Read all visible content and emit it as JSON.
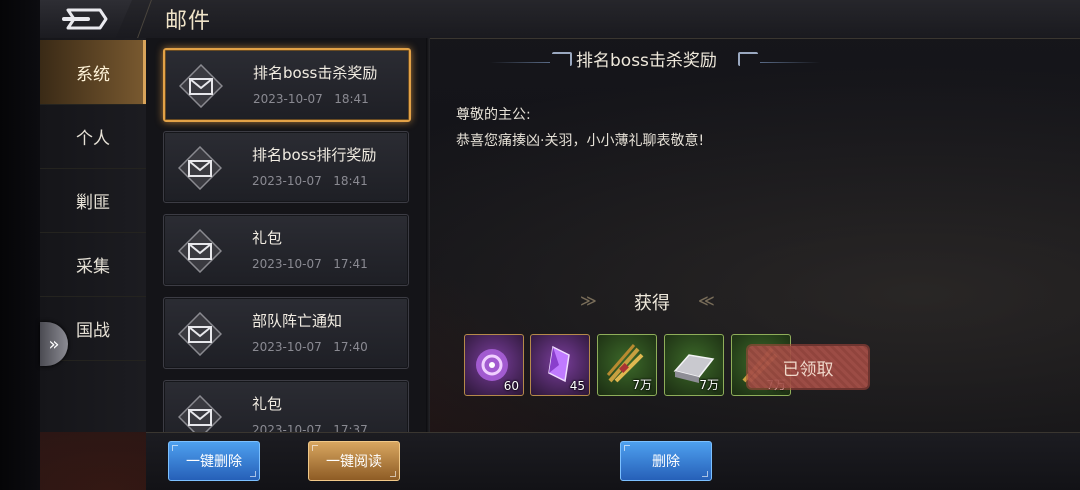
{
  "header": {
    "title": "邮件"
  },
  "sidebar": {
    "items": [
      {
        "label": "系统",
        "active": true
      },
      {
        "label": "个人"
      },
      {
        "label": "剿匪"
      },
      {
        "label": "采集"
      },
      {
        "label": "国战"
      }
    ]
  },
  "mails": [
    {
      "title": "排名boss击杀奖励",
      "date": "2023-10-07",
      "time": "18:41",
      "selected": true
    },
    {
      "title": "排名boss排行奖励",
      "date": "2023-10-07",
      "time": "18:41"
    },
    {
      "title": "礼包",
      "date": "2023-10-07",
      "time": "17:41"
    },
    {
      "title": "部队阵亡通知",
      "date": "2023-10-07",
      "time": "17:40"
    },
    {
      "title": "礼包",
      "date": "2023-10-07",
      "time": "17:37"
    }
  ],
  "detail": {
    "title": "排名boss击杀奖励",
    "greeting": "尊敬的主公:",
    "message": "恭喜您痛揍凶·关羽，小小薄礼聊表敬意!",
    "obtain_label": "获得",
    "rewards": [
      {
        "icon": "purple-orb-icon",
        "count": "60"
      },
      {
        "icon": "purple-crystal-icon",
        "count": "45"
      },
      {
        "icon": "grain-bundle-icon",
        "count": "7万"
      },
      {
        "icon": "iron-ingot-icon",
        "count": "7万"
      },
      {
        "icon": "grain-bundle-icon",
        "count": "7万"
      }
    ],
    "claimed_label": "已领取"
  },
  "buttons": {
    "delete_all": "一键删除",
    "read_all": "一键阅读",
    "delete": "删除"
  },
  "colors": {
    "accent_gold": "#e3a247",
    "button_blue": "#2f74cf",
    "button_gold": "#b27c3b"
  }
}
